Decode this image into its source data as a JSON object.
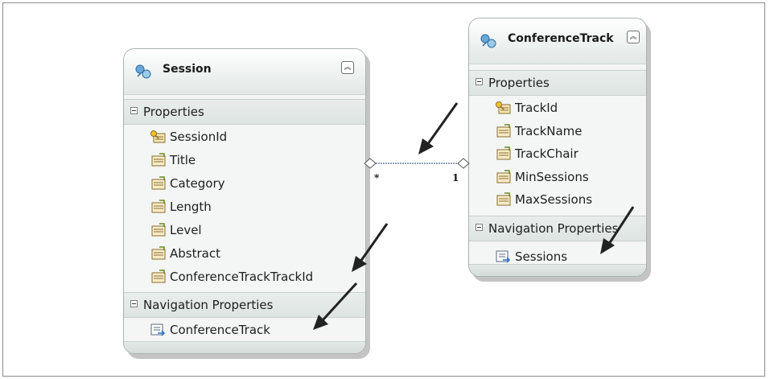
{
  "session": {
    "title": "Session",
    "properties_header": "Properties",
    "properties": [
      "SessionId",
      "Title",
      "Category",
      "Length",
      "Level",
      "Abstract",
      "ConferenceTrackTrackId"
    ],
    "key_property_index": 0,
    "nav_header": "Navigation Properties",
    "nav_properties": [
      "ConferenceTrack"
    ]
  },
  "track": {
    "title": "ConferenceTrack",
    "properties_header": "Properties",
    "properties": [
      "TrackId",
      "TrackName",
      "TrackChair",
      "MinSessions",
      "MaxSessions"
    ],
    "key_property_index": 0,
    "nav_header": "Navigation Properties",
    "nav_properties": [
      "Sessions"
    ]
  },
  "association": {
    "session_end_multiplicity": "*",
    "track_end_multiplicity": "1",
    "line_color": "#8fa2b8"
  },
  "icons": {
    "entity": "entity-type-icon",
    "key_property": "key-property-icon",
    "scalar_property": "scalar-property-icon",
    "navigation_property": "navigation-property-icon",
    "collapse": "collapse-chevron-icon",
    "annotation": "arrow-annotation-icon"
  }
}
